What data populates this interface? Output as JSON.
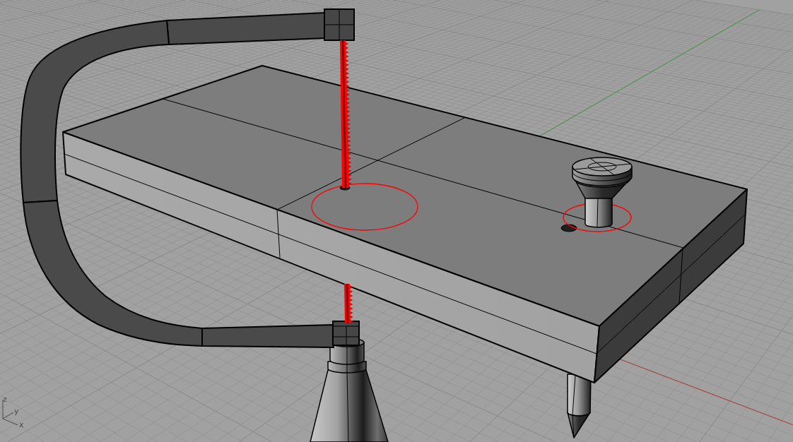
{
  "viewport": {
    "objects": [
      {
        "kind": "frame",
        "selected": false
      },
      {
        "kind": "blade",
        "selected": true
      },
      {
        "kind": "board",
        "selected": false
      },
      {
        "kind": "ring",
        "selected": true
      },
      {
        "kind": "knob",
        "selected": false
      },
      {
        "kind": "ring",
        "selected": true
      },
      {
        "kind": "handle",
        "selected": false
      },
      {
        "kind": "peg",
        "selected": false
      }
    ],
    "axis_icon": {
      "labels": [
        "z",
        "y",
        "x"
      ]
    }
  }
}
